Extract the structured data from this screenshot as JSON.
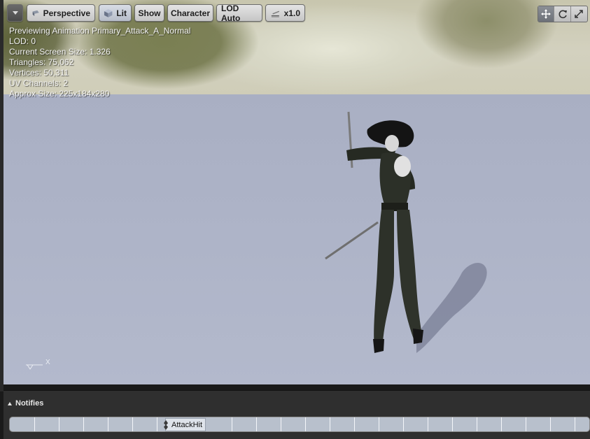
{
  "toolbar": {
    "menu_icon": "chevron-down-icon",
    "perspective_label": "Perspective",
    "lit_label": "Lit",
    "show_label": "Show",
    "character_label": "Character",
    "lod_label": "LOD Auto",
    "speed_label": "x1.0",
    "right_icons": [
      "translate-icon",
      "rotate-icon",
      "maximize-icon"
    ]
  },
  "stats": {
    "line1": "Previewing Animation Primary_Attack_A_Normal",
    "line2": "LOD: 0",
    "line3": "Current Screen Size: 1.326",
    "line4": "Triangles: 75,062",
    "line5": "Vertices: 50,311",
    "line6": "UV Channels: 2",
    "line7": "Approx Size: 225x184x280"
  },
  "axis": {
    "label": "X"
  },
  "notifies": {
    "title": "Notifies",
    "marker_label": "AttackHit"
  },
  "colors": {
    "viewport_ground": "#adb3c7",
    "panel_bg": "#2f2f2f",
    "track_bg": "#b8c0cc"
  }
}
